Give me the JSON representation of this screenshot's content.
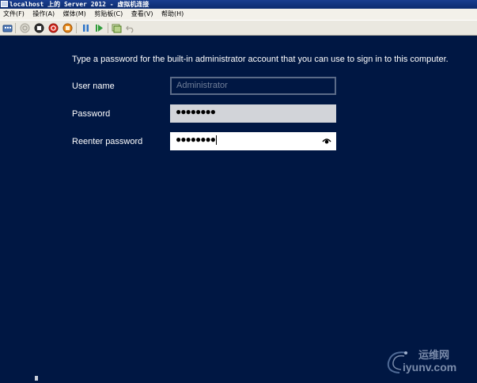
{
  "window": {
    "title": "localhost 上的 Server 2012 - 虚拟机连接"
  },
  "menu": {
    "items": [
      {
        "label": "文件(F)"
      },
      {
        "label": "操作(A)"
      },
      {
        "label": "媒体(M)"
      },
      {
        "label": "剪贴板(C)"
      },
      {
        "label": "查看(V)"
      },
      {
        "label": "帮助(H)"
      }
    ]
  },
  "toolbar": {
    "buttons": [
      {
        "name": "ctrl-alt-del-icon"
      },
      {
        "name": "start-icon"
      },
      {
        "name": "turn-off-icon"
      },
      {
        "name": "shut-down-icon"
      },
      {
        "name": "save-state-icon"
      },
      {
        "name": "pause-icon"
      },
      {
        "name": "resume-icon"
      },
      {
        "name": "snapshot-icon"
      },
      {
        "name": "revert-icon"
      }
    ]
  },
  "setup": {
    "instruction": "Type a password for the built-in administrator account that you can use to sign in to this computer.",
    "username_label": "User name",
    "username_placeholder": "Administrator",
    "password_label": "Password",
    "password_value": "●●●●●●●●",
    "reenter_label": "Reenter password",
    "reenter_value": "●●●●●●●●"
  },
  "watermark": {
    "cn_text": "运维网",
    "en_text": "iyunv.com"
  },
  "colors": {
    "screen_background": "#001743",
    "title_bar": "#0b2b6e",
    "toolbar": "#eae8e0"
  }
}
